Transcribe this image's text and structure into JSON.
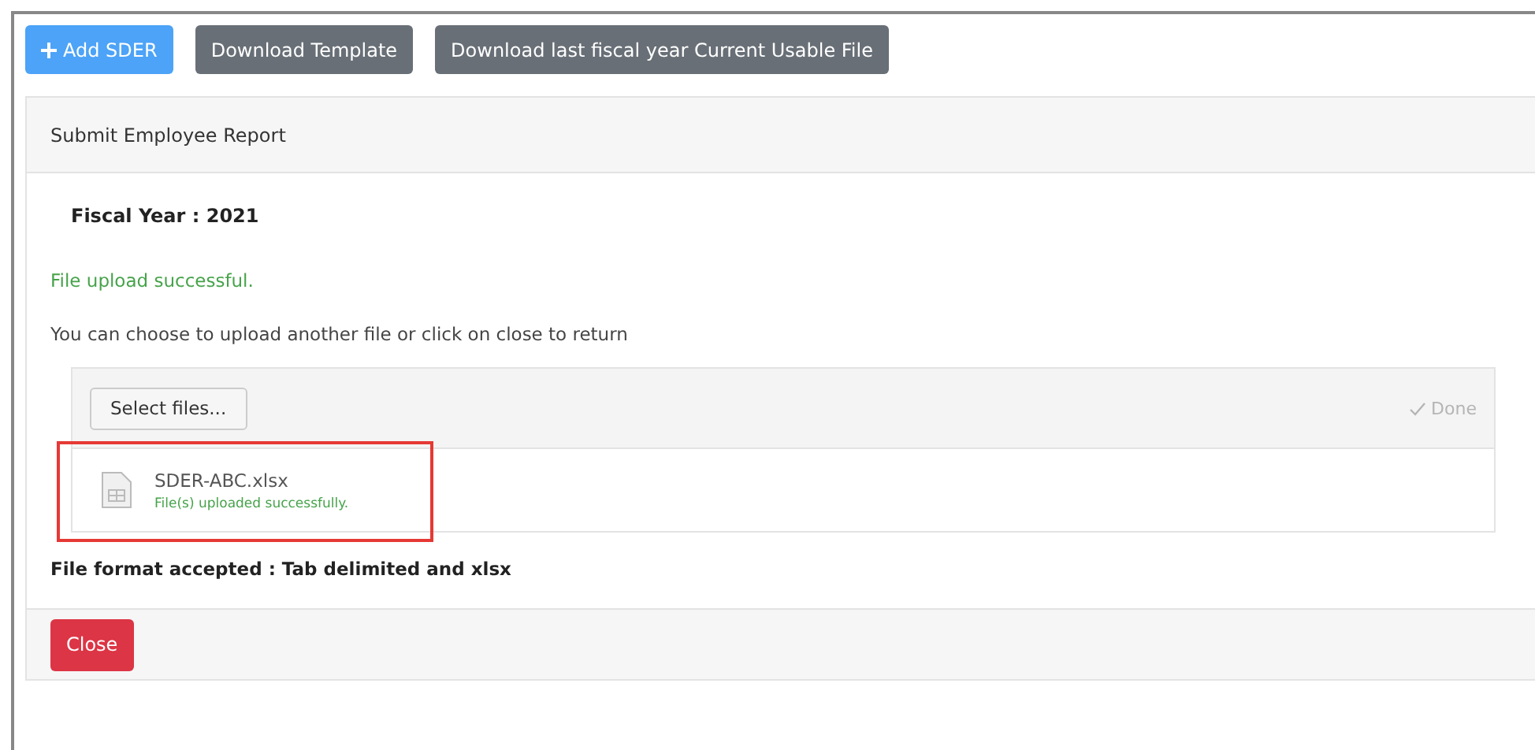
{
  "toolbar": [
    {
      "label": "Add SDER",
      "kind": "primary"
    },
    {
      "label": "Download Template",
      "kind": "secondary"
    },
    {
      "label": "Download last fiscal year Current Usable File",
      "kind": "secondary"
    }
  ],
  "panel": {
    "title": "Submit Employee Report",
    "fiscal_year": "Fiscal Year : 2021",
    "success_message": "File upload successful.",
    "instruction": "You can choose to upload another file or click on close to return",
    "upload": {
      "select_button": "Select files...",
      "done_label": "Done",
      "done_disabled": true,
      "files": [
        {
          "name": "SDER-ABC.xlsx",
          "status": "File(s) uploaded successfully.",
          "highlighted": true
        }
      ]
    },
    "format_note": "File format accepted : Tab delimited and xlsx",
    "footer_buttons": [
      {
        "label": "Close",
        "kind": "danger"
      }
    ]
  }
}
